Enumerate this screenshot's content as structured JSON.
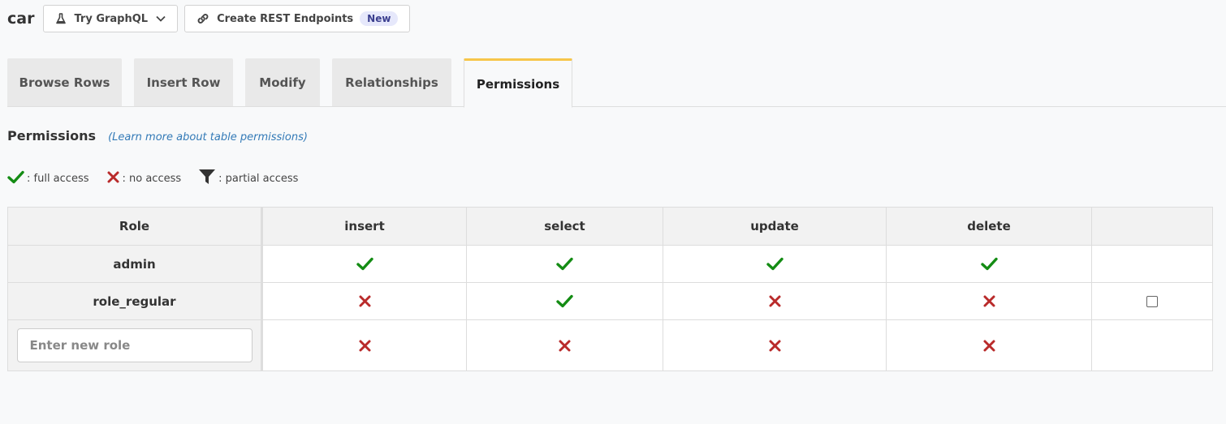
{
  "header": {
    "table_name": "car",
    "try_graphql_label": "Try GraphQL",
    "rest_label": "Create REST Endpoints",
    "rest_badge": "New"
  },
  "tabs": [
    {
      "label": "Browse Rows",
      "active": false
    },
    {
      "label": "Insert Row",
      "active": false
    },
    {
      "label": "Modify",
      "active": false
    },
    {
      "label": "Relationships",
      "active": false
    },
    {
      "label": "Permissions",
      "active": true
    }
  ],
  "permissions": {
    "title": "Permissions",
    "learn_more": "(Learn more about table permissions)"
  },
  "legend": {
    "full": ": full access",
    "none": ": no access",
    "partial": ": partial access"
  },
  "table": {
    "headers": [
      "Role",
      "insert",
      "select",
      "update",
      "delete",
      ""
    ],
    "rows": [
      {
        "role": "admin",
        "access": [
          "full",
          "full",
          "full",
          "full"
        ],
        "checkbox": false
      },
      {
        "role": "role_regular",
        "access": [
          "none",
          "full",
          "none",
          "none"
        ],
        "checkbox": true,
        "checked": false
      }
    ],
    "new_role": {
      "placeholder": "Enter new role",
      "access": [
        "none",
        "none",
        "none",
        "none"
      ]
    }
  },
  "colors": {
    "full": "#148c14",
    "none": "#b92b2b",
    "tab_accent": "#f7c64a",
    "link": "#337ab7"
  },
  "icons": {
    "full": "check-icon",
    "none": "cross-icon",
    "partial": "filter-icon"
  }
}
